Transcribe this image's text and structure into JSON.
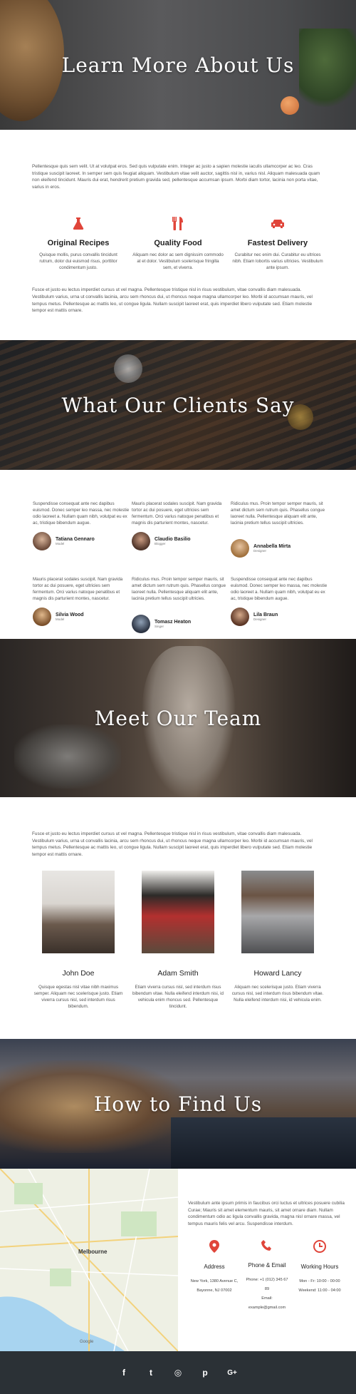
{
  "hero_about": {
    "title": "Learn More About Us"
  },
  "about": {
    "intro": "Pellentesque quis sem velit. Ut at volutpat eros. Sed quis vulputate enim. Integer ac justo a sapien molestie iaculis ullamcorper ac leo. Cras tristique suscipit laoreet. In semper sem quis feugiat aliquam. Vestibulum vitae velit auctor, sagittis nisl in, varius nisl. Aliquam malesuada quam non eleifend tincidunt. Mauris dui erat, hendrerit pretium gravida sed, pellentesque accumsan ipsum. Morbi diam tortor, lacinia non porta vitae, varius in eros.",
    "features": [
      {
        "icon": "flask-icon",
        "title": "Original Recipes",
        "text": "Quisque mollis, purus convallis tincidunt rutrum, dolor dui euismod risus, porttitor condimentum justo."
      },
      {
        "icon": "fork-knife-icon",
        "title": "Quality Food",
        "text": "Aliquam nec dolor ac sem dignissim commodo at et dolor. Vestibulum scelerisque fringilla sem, et viverra."
      },
      {
        "icon": "car-icon",
        "title": "Fastest Delivery",
        "text": "Curabitur nec enim dui. Curabitur eu ultrices nibh. Etiam lobortis varius ultricies. Vestibulum ante ipsum."
      }
    ],
    "outro": "Fusce et justo eu lectus imperdiet cursus ut vel magna. Pellentesque tristique nisl in risus vestibulum, vitae convallis diam malesuada. Vestibulum varius, urna ut convallis lacinia, arcu sem rhoncus dui, ut rhoncus neque magna ullamcorper leo. Morbi id accumsan mauris, vel tempus metus. Pellentesque ac mattis leo, ut congue ligula. Nullam suscipit laoreet erat, quis imperdiet libero vulputate sed. Etiam molestie tempor est mattis ornare."
  },
  "hero_clients": {
    "title": "What Our Clients Say"
  },
  "testimonials": [
    {
      "text": "Suspendisse consequat ante nec dapibus euismod. Donec semper leo massa, nec molestie odio laoreet a. Nullam quam nibh, volutpat eu ex ac, tristique bibendum augue.",
      "name": "Tatiana Gennaro",
      "role": "Model"
    },
    {
      "text": "Mauris placerat sodales suscipit. Nam gravida tortor ac dui posuere, eget ultricies sem fermentum. Orci varius natoque penatibus et magnis dis parturient montes, nascetur.",
      "name": "Claudio Basilio",
      "role": "Blogger"
    },
    {
      "text": "Ridiculus mus. Proin tempor semper mauris, sit amet dictum sem rutrum quis. Phasellus congue laoreet nulla. Pellentesque aliquam elit ante, lacinia pretium tellus suscipit ultricies.",
      "name": "Annabella Mirta",
      "role": "Designer"
    },
    {
      "text": "Mauris placerat sodales suscipit. Nam gravida tortor ac dui posuere, eget ultricies sem fermentum. Orci varius natoque penatibus et magnis dis parturient montes, nascetur.",
      "name": "Silvia Wood",
      "role": "Model"
    },
    {
      "text": "Ridiculus mus. Proin tempor semper mauris, sit amet dictum sem rutrum quis. Phasellus congue laoreet nulla. Pellentesque aliquam elit ante, lacinia pretium tellus suscipit ultricies.",
      "name": "Tomasz Heaton",
      "role": "Singer"
    },
    {
      "text": "Suspendisse consequat ante nec dapibus euismod. Donec semper leo massa, nec molestie odio laoreet a. Nullam quam nibh, volutpat eu ex ac, tristique bibendum augue.",
      "name": "Lila Braun",
      "role": "Designer"
    }
  ],
  "hero_team": {
    "title": "Meet Our Team"
  },
  "team": {
    "intro": "Fusce et justo eu lectus imperdiet cursus ut vel magna. Pellentesque tristique nisl in risus vestibulum, vitae convallis diam malesuada. Vestibulum varius, urna ut convallis lacinia, arcu sem rhoncus dui, ut rhoncus neque magna ullamcorper leo. Morbi id accumsan mauris, vel tempus metus. Pellentesque ac mattis leo, ut congue ligula. Nullam suscipit laoreet erat, quis imperdiet libero vulputate sed. Etiam molestie tempor est mattis ornare.",
    "members": [
      {
        "name": "John Doe",
        "text": "Quisque egestas nisl vitae nibh maximus semper. Aliquam nec scelerisque justo. Etiam viverra cursus nisl, sed interdum risus bibendum."
      },
      {
        "name": "Adam Smith",
        "text": "Etiam viverra cursus nisl, sed interdum risus bibendum vitae. Nulla eleifend interdum nisi, id vehicula enim rhoncus sed. Pellentesque tincidunt."
      },
      {
        "name": "Howard Lancy",
        "text": "Aliquam nec scelerisque justo. Etiam viverra cursus nisl, sed interdum risus bibendum vitae. Nulla eleifend interdum nisi, id vehicula enim."
      }
    ]
  },
  "hero_find": {
    "title": "How to Find Us"
  },
  "map": {
    "city_label": "Melbourne",
    "credit": "Google"
  },
  "contact": {
    "intro": "Vestibulum ante ipsum primis in faucibus orci luctus et ultrices posuere cubilia Curae; Mauris sit amet elementum mauris, sit amet ornare diam. Nullam condimentum odio ac ligula convallis gravida, magna nisl ornare massa, vel tempus mauris felis vel arcu. Suspendisse interdum.",
    "address": {
      "icon": "map-pin-icon",
      "title": "Address",
      "line1": "New York, 1380 Avenue C,",
      "line2": "Bayonne, NJ 07002"
    },
    "phone": {
      "icon": "phone-icon",
      "title": "Phone & Email",
      "line1": "Phone: +1 (012) 345 67",
      "line2": "89",
      "line3": "Email:",
      "line4": "example@gmail.com"
    },
    "hours": {
      "icon": "clock-icon",
      "title": "Working Hours",
      "line1": "Mon - Fr: 10:00 - 00:00",
      "line2": "Weekend: 11:00 - 04:00"
    }
  },
  "footer": {
    "social": [
      {
        "icon": "facebook-icon",
        "glyph": "f"
      },
      {
        "icon": "twitter-icon",
        "glyph": "t"
      },
      {
        "icon": "instagram-icon",
        "glyph": "◎"
      },
      {
        "icon": "pinterest-icon",
        "glyph": "p"
      },
      {
        "icon": "google-plus-icon",
        "glyph": "G+"
      }
    ]
  },
  "colors": {
    "accent": "#e0453a",
    "footer_bg": "#2b3136"
  }
}
